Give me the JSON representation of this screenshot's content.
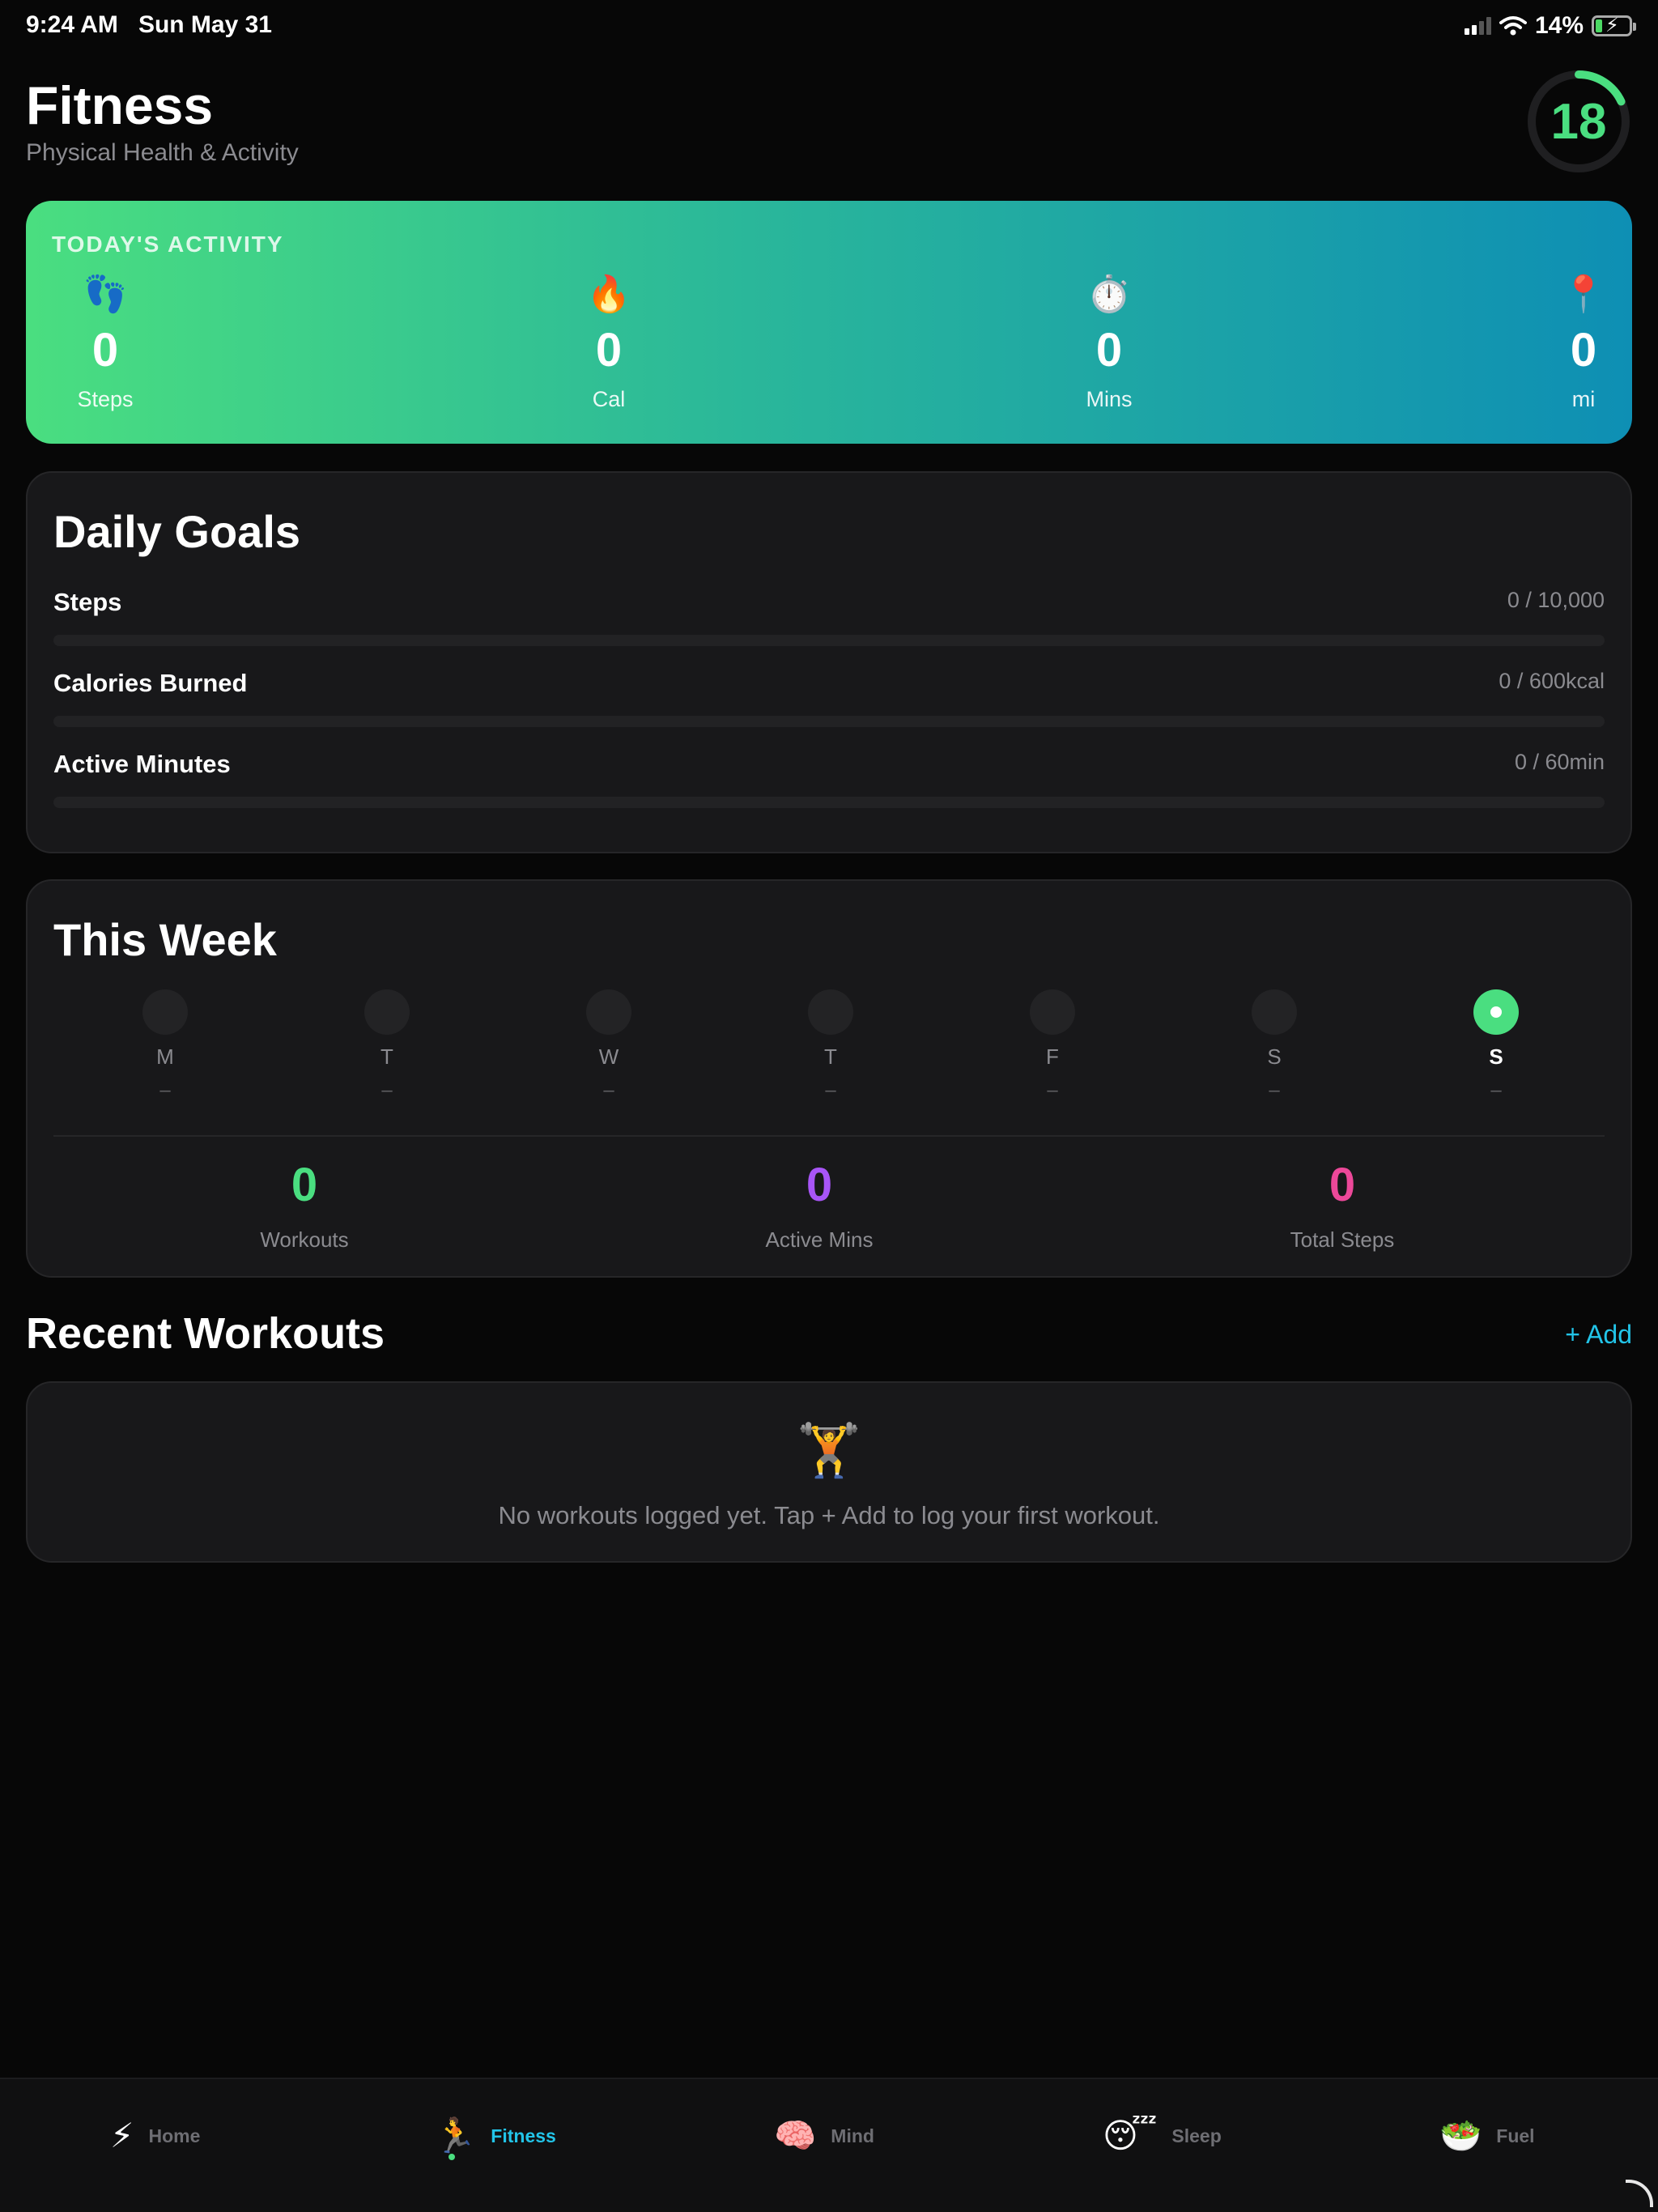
{
  "status_bar": {
    "time": "9:24 AM",
    "date": "Sun May 31",
    "battery_percent": "14%",
    "charging": true
  },
  "header": {
    "title": "Fitness",
    "subtitle": "Physical Health & Activity",
    "score": "18",
    "score_fraction": 0.18,
    "accent_color": "#4ade80"
  },
  "activity": {
    "heading": "TODAY'S ACTIVITY",
    "metrics": [
      {
        "icon": "footprints-icon",
        "glyph": "👣",
        "value": "0",
        "label": "Steps"
      },
      {
        "icon": "fire-icon",
        "glyph": "🔥",
        "value": "0",
        "label": "Cal"
      },
      {
        "icon": "stopwatch-icon",
        "glyph": "⏱️",
        "value": "0",
        "label": "Mins"
      },
      {
        "icon": "map-pin-icon",
        "glyph": "📍",
        "value": "0",
        "label": "mi"
      }
    ]
  },
  "goals": {
    "title": "Daily Goals",
    "items": [
      {
        "label": "Steps",
        "value": "0 / 10,000",
        "progress": 0
      },
      {
        "label": "Calories Burned",
        "value": "0 / 600kcal",
        "progress": 0
      },
      {
        "label": "Active Minutes",
        "value": "0 / 60min",
        "progress": 0
      }
    ]
  },
  "week": {
    "title": "This Week",
    "days": [
      {
        "label": "M",
        "value": "–",
        "active": false
      },
      {
        "label": "T",
        "value": "–",
        "active": false
      },
      {
        "label": "W",
        "value": "–",
        "active": false
      },
      {
        "label": "T",
        "value": "–",
        "active": false
      },
      {
        "label": "F",
        "value": "–",
        "active": false
      },
      {
        "label": "S",
        "value": "–",
        "active": false
      },
      {
        "label": "S",
        "value": "–",
        "active": true
      }
    ],
    "stats": [
      {
        "value": "0",
        "label": "Workouts",
        "color": "#4ade80"
      },
      {
        "value": "0",
        "label": "Active Mins",
        "color": "#a855f7"
      },
      {
        "value": "0",
        "label": "Total Steps",
        "color": "#ec4899"
      }
    ]
  },
  "recent": {
    "title": "Recent Workouts",
    "add_label": "+ Add",
    "empty_glyph": "🏋️",
    "empty_icon": "weightlifter-icon",
    "empty_text": "No workouts logged yet. Tap + Add to log your first workout."
  },
  "tabs": [
    {
      "label": "Home",
      "glyph": "⚡",
      "icon": "lightning-icon",
      "active": false
    },
    {
      "label": "Fitness",
      "glyph": "🏃",
      "icon": "runner-icon",
      "active": true
    },
    {
      "label": "Mind",
      "glyph": "🧠",
      "icon": "brain-icon",
      "active": false
    },
    {
      "label": "Sleep",
      "glyph": "😴",
      "icon": "sleeping-face-icon",
      "active": false
    },
    {
      "label": "Fuel",
      "glyph": "🥗",
      "icon": "salad-icon",
      "active": false
    }
  ]
}
